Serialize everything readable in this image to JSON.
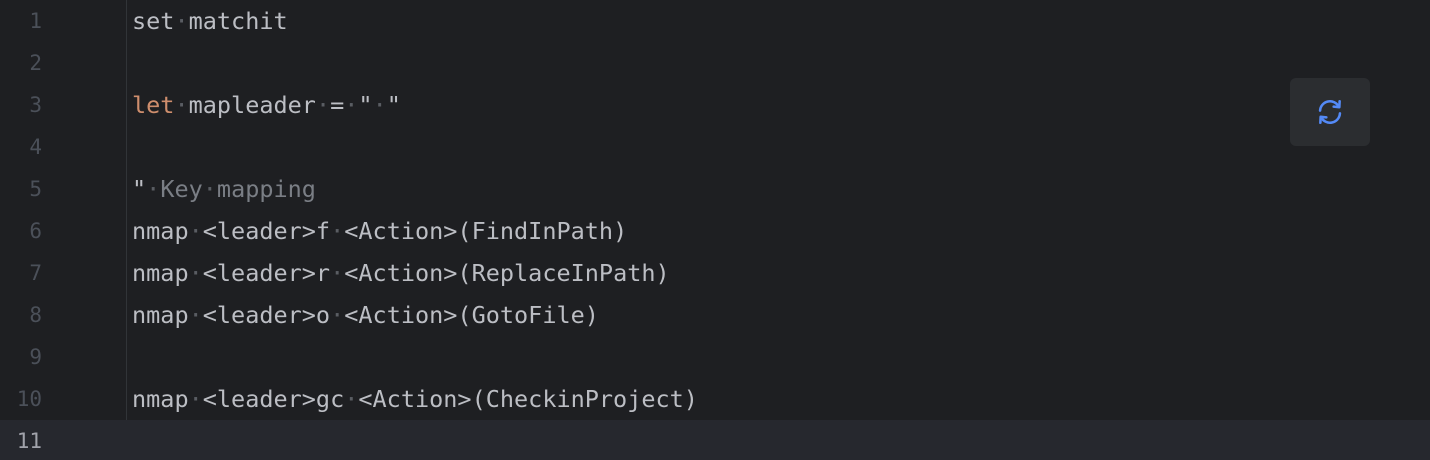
{
  "editor": {
    "lines": [
      {
        "number": "1",
        "tokens": [
          {
            "t": "set",
            "c": "text"
          },
          {
            "t": "·",
            "c": "ws"
          },
          {
            "t": "matchit",
            "c": "text"
          }
        ]
      },
      {
        "number": "2",
        "tokens": []
      },
      {
        "number": "3",
        "tokens": [
          {
            "t": "let",
            "c": "kw"
          },
          {
            "t": "·",
            "c": "ws"
          },
          {
            "t": "mapleader",
            "c": "text"
          },
          {
            "t": "·",
            "c": "ws"
          },
          {
            "t": "=",
            "c": "text"
          },
          {
            "t": "·",
            "c": "ws"
          },
          {
            "t": "\"",
            "c": "text"
          },
          {
            "t": "·",
            "c": "ws"
          },
          {
            "t": "\"",
            "c": "text"
          }
        ]
      },
      {
        "number": "4",
        "tokens": []
      },
      {
        "number": "5",
        "tokens": [
          {
            "t": "\"",
            "c": "text"
          },
          {
            "t": "·",
            "c": "ws"
          },
          {
            "t": "Key",
            "c": "cm"
          },
          {
            "t": "·",
            "c": "ws"
          },
          {
            "t": "mapping",
            "c": "cm"
          }
        ]
      },
      {
        "number": "6",
        "tokens": [
          {
            "t": "nmap",
            "c": "text"
          },
          {
            "t": "·",
            "c": "ws"
          },
          {
            "t": "<leader>f",
            "c": "text"
          },
          {
            "t": "·",
            "c": "ws"
          },
          {
            "t": "<Action>(FindInPath)",
            "c": "text"
          }
        ]
      },
      {
        "number": "7",
        "tokens": [
          {
            "t": "nmap",
            "c": "text"
          },
          {
            "t": "·",
            "c": "ws"
          },
          {
            "t": "<leader>r",
            "c": "text"
          },
          {
            "t": "·",
            "c": "ws"
          },
          {
            "t": "<Action>(ReplaceInPath)",
            "c": "text"
          }
        ]
      },
      {
        "number": "8",
        "tokens": [
          {
            "t": "nmap",
            "c": "text"
          },
          {
            "t": "·",
            "c": "ws"
          },
          {
            "t": "<leader>o",
            "c": "text"
          },
          {
            "t": "·",
            "c": "ws"
          },
          {
            "t": "<Action>(GotoFile)",
            "c": "text"
          }
        ]
      },
      {
        "number": "9",
        "tokens": []
      },
      {
        "number": "10",
        "tokens": [
          {
            "t": "nmap",
            "c": "text"
          },
          {
            "t": "·",
            "c": "ws"
          },
          {
            "t": "<leader>gc",
            "c": "text"
          },
          {
            "t": "·",
            "c": "ws"
          },
          {
            "t": "<Action>(CheckinProject)",
            "c": "text"
          }
        ]
      },
      {
        "number": "11",
        "tokens": [],
        "current": true
      }
    ]
  },
  "reload_button": {
    "icon": "reload-icon",
    "icon_color": "#548af7"
  },
  "colors": {
    "background": "#1e1f22",
    "current_line": "#26282e",
    "keyword": "#cf8e6d",
    "comment": "#7a7e85",
    "text": "#bcbec4"
  }
}
